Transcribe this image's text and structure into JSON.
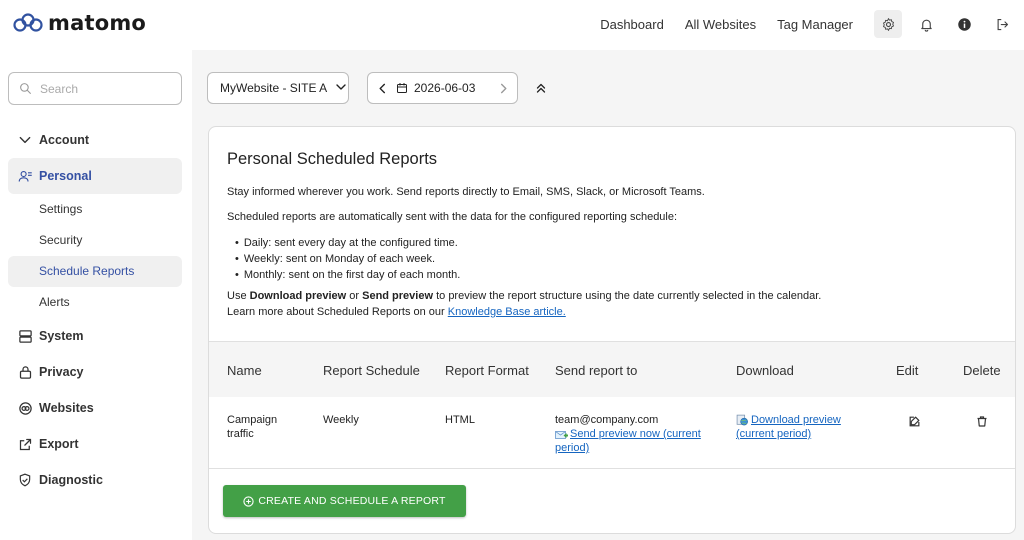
{
  "header": {
    "logo_text": "matomo",
    "nav": [
      "Dashboard",
      "All Websites",
      "Tag Manager"
    ],
    "icons": [
      "gear-icon",
      "bell-icon",
      "info-icon",
      "logout-icon"
    ]
  },
  "sidebar": {
    "search_placeholder": "Search",
    "items": {
      "account": "Account",
      "personal": "Personal",
      "settings": "Settings",
      "security": "Security",
      "schedule_reports": "Schedule Reports",
      "alerts": "Alerts",
      "system": "System",
      "privacy": "Privacy",
      "websites": "Websites",
      "export": "Export",
      "diagnostic": "Diagnostic"
    }
  },
  "toolbar": {
    "site": "MyWebsite - SITE A",
    "date": "2026-06-03"
  },
  "card": {
    "title": "Personal Scheduled Reports",
    "intro": "Stay informed wherever you work. Send reports directly to Email, SMS, Slack, or Microsoft Teams.",
    "schedule_note": "Scheduled reports are automatically sent with the data for the configured reporting schedule:",
    "bullets": [
      "Daily: sent every day at the configured time.",
      "Weekly: sent on Monday of each week.",
      "Monthly: sent on the first day of each month."
    ],
    "preview_use": "Use ",
    "preview_download": "Download preview",
    "preview_or": " or ",
    "preview_send": "Send preview",
    "preview_rest": " to preview the report structure using the date currently selected in the calendar.",
    "learn_more": "Learn more about Scheduled Reports on our ",
    "kb_link": "Knowledge Base article."
  },
  "table": {
    "headers": [
      "Name",
      "Report Schedule",
      "Report Format",
      "Send report to",
      "Download",
      "Edit",
      "Delete"
    ],
    "rows": [
      {
        "name_line1": "Campaign",
        "name_line2": "traffic",
        "schedule": "Weekly",
        "format": "HTML",
        "send_to": "team@company.com",
        "send_preview_line1": "Send preview now (current",
        "send_preview_line2": "period)",
        "download_line1": "Download preview",
        "download_line2": "(current period)"
      }
    ]
  },
  "create_button": "CREATE AND SCHEDULE A REPORT",
  "colors": {
    "accent": "#3450a3",
    "create_green": "#43a047",
    "link": "#1565c0",
    "logo_blue": "#3152a0"
  }
}
